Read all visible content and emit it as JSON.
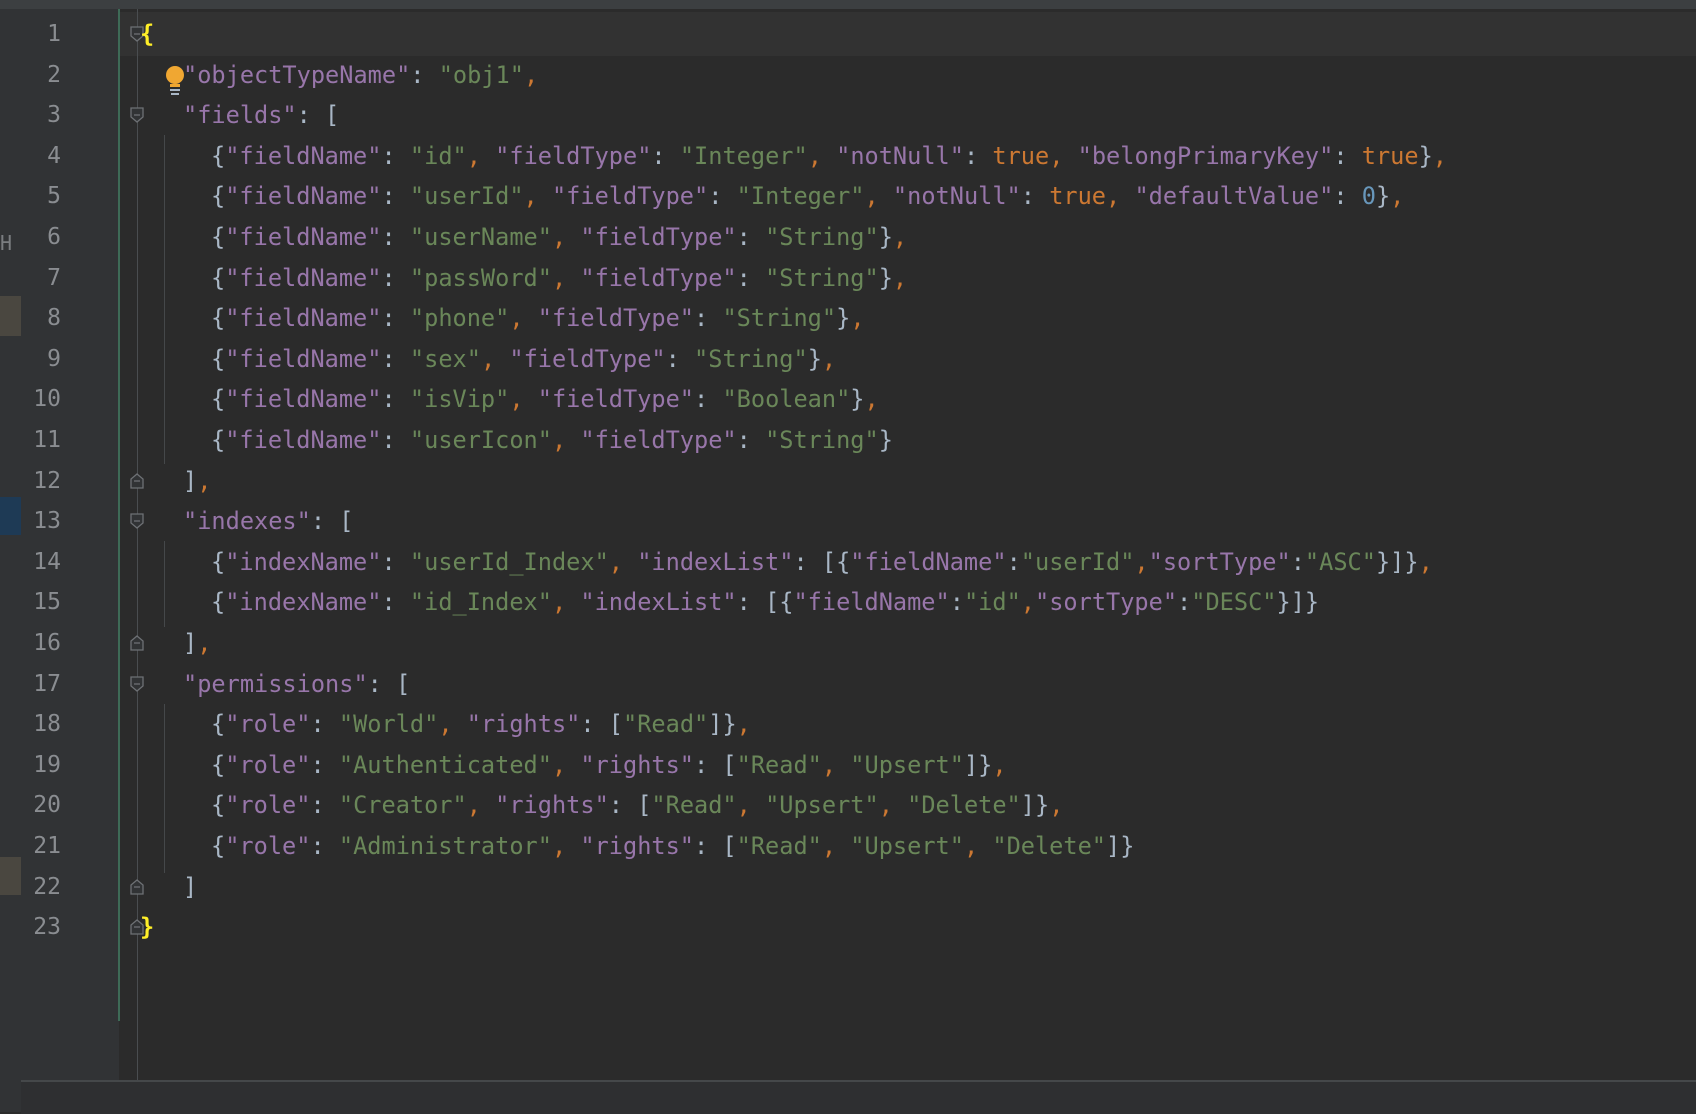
{
  "editor": {
    "line_numbers": [
      "1",
      "2",
      "3",
      "4",
      "5",
      "6",
      "7",
      "8",
      "9",
      "10",
      "11",
      "12",
      "13",
      "14",
      "15",
      "16",
      "17",
      "18",
      "19",
      "20",
      "21",
      "22",
      "23"
    ],
    "left_panel_clip": "H",
    "lines": [
      [
        {
          "c": "brace-hl",
          "t": "{"
        }
      ],
      [
        {
          "c": "k",
          "t": "\"objectTypeName\""
        },
        {
          "c": "b",
          "t": ": "
        },
        {
          "c": "s",
          "t": "\"obj1\""
        },
        {
          "c": "p",
          "t": ","
        }
      ],
      [
        {
          "c": "k",
          "t": "\"fields\""
        },
        {
          "c": "b",
          "t": ": ["
        }
      ],
      [
        {
          "c": "b",
          "t": "{"
        },
        {
          "c": "k",
          "t": "\"fieldName\""
        },
        {
          "c": "b",
          "t": ": "
        },
        {
          "c": "s",
          "t": "\"id\""
        },
        {
          "c": "p",
          "t": ", "
        },
        {
          "c": "k",
          "t": "\"fieldType\""
        },
        {
          "c": "b",
          "t": ": "
        },
        {
          "c": "s",
          "t": "\"Integer\""
        },
        {
          "c": "p",
          "t": ", "
        },
        {
          "c": "k",
          "t": "\"notNull\""
        },
        {
          "c": "b",
          "t": ": "
        },
        {
          "c": "kw",
          "t": "true"
        },
        {
          "c": "p",
          "t": ", "
        },
        {
          "c": "k",
          "t": "\"belongPrimaryKey\""
        },
        {
          "c": "b",
          "t": ": "
        },
        {
          "c": "kw",
          "t": "true"
        },
        {
          "c": "b",
          "t": "}"
        },
        {
          "c": "p",
          "t": ","
        }
      ],
      [
        {
          "c": "b",
          "t": "{"
        },
        {
          "c": "k",
          "t": "\"fieldName\""
        },
        {
          "c": "b",
          "t": ": "
        },
        {
          "c": "s",
          "t": "\"userId\""
        },
        {
          "c": "p",
          "t": ", "
        },
        {
          "c": "k",
          "t": "\"fieldType\""
        },
        {
          "c": "b",
          "t": ": "
        },
        {
          "c": "s",
          "t": "\"Integer\""
        },
        {
          "c": "p",
          "t": ", "
        },
        {
          "c": "k",
          "t": "\"notNull\""
        },
        {
          "c": "b",
          "t": ": "
        },
        {
          "c": "kw",
          "t": "true"
        },
        {
          "c": "p",
          "t": ", "
        },
        {
          "c": "k",
          "t": "\"defaultValue\""
        },
        {
          "c": "b",
          "t": ": "
        },
        {
          "c": "n",
          "t": "0"
        },
        {
          "c": "b",
          "t": "}"
        },
        {
          "c": "p",
          "t": ","
        }
      ],
      [
        {
          "c": "b",
          "t": "{"
        },
        {
          "c": "k",
          "t": "\"fieldName\""
        },
        {
          "c": "b",
          "t": ": "
        },
        {
          "c": "s",
          "t": "\"userName\""
        },
        {
          "c": "p",
          "t": ", "
        },
        {
          "c": "k",
          "t": "\"fieldType\""
        },
        {
          "c": "b",
          "t": ": "
        },
        {
          "c": "s",
          "t": "\"String\""
        },
        {
          "c": "b",
          "t": "}"
        },
        {
          "c": "p",
          "t": ","
        }
      ],
      [
        {
          "c": "b",
          "t": "{"
        },
        {
          "c": "k",
          "t": "\"fieldName\""
        },
        {
          "c": "b",
          "t": ": "
        },
        {
          "c": "s",
          "t": "\"passWord\""
        },
        {
          "c": "p",
          "t": ", "
        },
        {
          "c": "k",
          "t": "\"fieldType\""
        },
        {
          "c": "b",
          "t": ": "
        },
        {
          "c": "s",
          "t": "\"String\""
        },
        {
          "c": "b",
          "t": "}"
        },
        {
          "c": "p",
          "t": ","
        }
      ],
      [
        {
          "c": "b",
          "t": "{"
        },
        {
          "c": "k",
          "t": "\"fieldName\""
        },
        {
          "c": "b",
          "t": ": "
        },
        {
          "c": "s",
          "t": "\"phone\""
        },
        {
          "c": "p",
          "t": ", "
        },
        {
          "c": "k",
          "t": "\"fieldType\""
        },
        {
          "c": "b",
          "t": ": "
        },
        {
          "c": "s",
          "t": "\"String\""
        },
        {
          "c": "b",
          "t": "}"
        },
        {
          "c": "p",
          "t": ","
        }
      ],
      [
        {
          "c": "b",
          "t": "{"
        },
        {
          "c": "k",
          "t": "\"fieldName\""
        },
        {
          "c": "b",
          "t": ": "
        },
        {
          "c": "s",
          "t": "\"sex\""
        },
        {
          "c": "p",
          "t": ", "
        },
        {
          "c": "k",
          "t": "\"fieldType\""
        },
        {
          "c": "b",
          "t": ": "
        },
        {
          "c": "s",
          "t": "\"String\""
        },
        {
          "c": "b",
          "t": "}"
        },
        {
          "c": "p",
          "t": ","
        }
      ],
      [
        {
          "c": "b",
          "t": "{"
        },
        {
          "c": "k",
          "t": "\"fieldName\""
        },
        {
          "c": "b",
          "t": ": "
        },
        {
          "c": "s",
          "t": "\"isVip\""
        },
        {
          "c": "p",
          "t": ", "
        },
        {
          "c": "k",
          "t": "\"fieldType\""
        },
        {
          "c": "b",
          "t": ": "
        },
        {
          "c": "s",
          "t": "\"Boolean\""
        },
        {
          "c": "b",
          "t": "}"
        },
        {
          "c": "p",
          "t": ","
        }
      ],
      [
        {
          "c": "b",
          "t": "{"
        },
        {
          "c": "k",
          "t": "\"fieldName\""
        },
        {
          "c": "b",
          "t": ": "
        },
        {
          "c": "s",
          "t": "\"userIcon\""
        },
        {
          "c": "p",
          "t": ", "
        },
        {
          "c": "k",
          "t": "\"fieldType\""
        },
        {
          "c": "b",
          "t": ": "
        },
        {
          "c": "s",
          "t": "\"String\""
        },
        {
          "c": "b",
          "t": "}"
        }
      ],
      [
        {
          "c": "b",
          "t": "]"
        },
        {
          "c": "p",
          "t": ","
        }
      ],
      [
        {
          "c": "k",
          "t": "\"indexes\""
        },
        {
          "c": "b",
          "t": ": ["
        }
      ],
      [
        {
          "c": "b",
          "t": "{"
        },
        {
          "c": "k",
          "t": "\"indexName\""
        },
        {
          "c": "b",
          "t": ": "
        },
        {
          "c": "s",
          "t": "\"userId_Index\""
        },
        {
          "c": "p",
          "t": ", "
        },
        {
          "c": "k",
          "t": "\"indexList\""
        },
        {
          "c": "b",
          "t": ": [{"
        },
        {
          "c": "k",
          "t": "\"fieldName\""
        },
        {
          "c": "b",
          "t": ":"
        },
        {
          "c": "s",
          "t": "\"userId\""
        },
        {
          "c": "p",
          "t": ","
        },
        {
          "c": "k",
          "t": "\"sortType\""
        },
        {
          "c": "b",
          "t": ":"
        },
        {
          "c": "s",
          "t": "\"ASC\""
        },
        {
          "c": "b",
          "t": "}]}"
        },
        {
          "c": "p",
          "t": ","
        }
      ],
      [
        {
          "c": "b",
          "t": "{"
        },
        {
          "c": "k",
          "t": "\"indexName\""
        },
        {
          "c": "b",
          "t": ": "
        },
        {
          "c": "s",
          "t": "\"id_Index\""
        },
        {
          "c": "p",
          "t": ", "
        },
        {
          "c": "k",
          "t": "\"indexList\""
        },
        {
          "c": "b",
          "t": ": [{"
        },
        {
          "c": "k",
          "t": "\"fieldName\""
        },
        {
          "c": "b",
          "t": ":"
        },
        {
          "c": "s",
          "t": "\"id\""
        },
        {
          "c": "p",
          "t": ","
        },
        {
          "c": "k",
          "t": "\"sortType\""
        },
        {
          "c": "b",
          "t": ":"
        },
        {
          "c": "s",
          "t": "\"DESC\""
        },
        {
          "c": "b",
          "t": "}]}"
        }
      ],
      [
        {
          "c": "b",
          "t": "]"
        },
        {
          "c": "p",
          "t": ","
        }
      ],
      [
        {
          "c": "k",
          "t": "\"permissions\""
        },
        {
          "c": "b",
          "t": ": ["
        }
      ],
      [
        {
          "c": "b",
          "t": "{"
        },
        {
          "c": "k",
          "t": "\"role\""
        },
        {
          "c": "b",
          "t": ": "
        },
        {
          "c": "s",
          "t": "\"World\""
        },
        {
          "c": "p",
          "t": ", "
        },
        {
          "c": "k",
          "t": "\"rights\""
        },
        {
          "c": "b",
          "t": ": ["
        },
        {
          "c": "s",
          "t": "\"Read\""
        },
        {
          "c": "b",
          "t": "]}"
        },
        {
          "c": "p",
          "t": ","
        }
      ],
      [
        {
          "c": "b",
          "t": "{"
        },
        {
          "c": "k",
          "t": "\"role\""
        },
        {
          "c": "b",
          "t": ": "
        },
        {
          "c": "s",
          "t": "\"Authenticated\""
        },
        {
          "c": "p",
          "t": ", "
        },
        {
          "c": "k",
          "t": "\"rights\""
        },
        {
          "c": "b",
          "t": ": ["
        },
        {
          "c": "s",
          "t": "\"Read\""
        },
        {
          "c": "p",
          "t": ", "
        },
        {
          "c": "s",
          "t": "\"Upsert\""
        },
        {
          "c": "b",
          "t": "]}"
        },
        {
          "c": "p",
          "t": ","
        }
      ],
      [
        {
          "c": "b",
          "t": "{"
        },
        {
          "c": "k",
          "t": "\"role\""
        },
        {
          "c": "b",
          "t": ": "
        },
        {
          "c": "s",
          "t": "\"Creator\""
        },
        {
          "c": "p",
          "t": ", "
        },
        {
          "c": "k",
          "t": "\"rights\""
        },
        {
          "c": "b",
          "t": ": ["
        },
        {
          "c": "s",
          "t": "\"Read\""
        },
        {
          "c": "p",
          "t": ", "
        },
        {
          "c": "s",
          "t": "\"Upsert\""
        },
        {
          "c": "p",
          "t": ", "
        },
        {
          "c": "s",
          "t": "\"Delete\""
        },
        {
          "c": "b",
          "t": "]}"
        },
        {
          "c": "p",
          "t": ","
        }
      ],
      [
        {
          "c": "b",
          "t": "{"
        },
        {
          "c": "k",
          "t": "\"role\""
        },
        {
          "c": "b",
          "t": ": "
        },
        {
          "c": "s",
          "t": "\"Administrator\""
        },
        {
          "c": "p",
          "t": ", "
        },
        {
          "c": "k",
          "t": "\"rights\""
        },
        {
          "c": "b",
          "t": ": ["
        },
        {
          "c": "s",
          "t": "\"Read\""
        },
        {
          "c": "p",
          "t": ", "
        },
        {
          "c": "s",
          "t": "\"Upsert\""
        },
        {
          "c": "p",
          "t": ", "
        },
        {
          "c": "s",
          "t": "\"Delete\""
        },
        {
          "c": "b",
          "t": "]}"
        }
      ],
      [
        {
          "c": "b",
          "t": "]"
        }
      ],
      [
        {
          "c": "brace-hl",
          "t": "}"
        }
      ]
    ]
  },
  "icons": {
    "intention_bulb": "lightbulb-icon",
    "fold": "fold-marker-icon"
  },
  "colors": {
    "background": "#2b2b2b",
    "gutter": "#313335",
    "key": "#9876aa",
    "string": "#6a8759",
    "keyword": "#cc7832",
    "number": "#6897bb",
    "brace_match": "#ffef28"
  }
}
